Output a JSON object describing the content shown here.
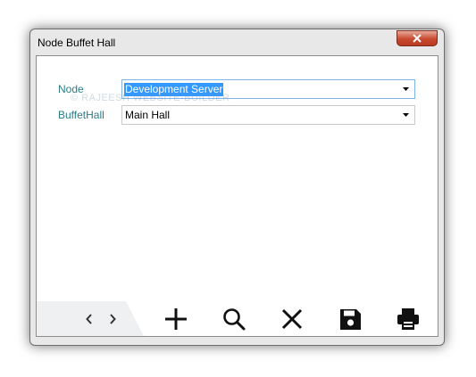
{
  "window": {
    "title": "Node Buffet Hall",
    "close_icon": "close-icon",
    "accent_close": "#c8492f"
  },
  "form": {
    "node": {
      "label": "Node",
      "value": "Development Server"
    },
    "buffet_hall": {
      "label": "BuffetHall",
      "value": "Main Hall"
    },
    "label_color": "#2b7d87"
  },
  "watermark": {
    "text": "© RAJEESH WEBSITE-BUILDER"
  },
  "toolbar": {
    "icons": [
      "chevron-left-icon",
      "chevron-right-icon",
      "plus-icon",
      "search-icon",
      "close-icon",
      "save-icon",
      "print-icon"
    ]
  }
}
